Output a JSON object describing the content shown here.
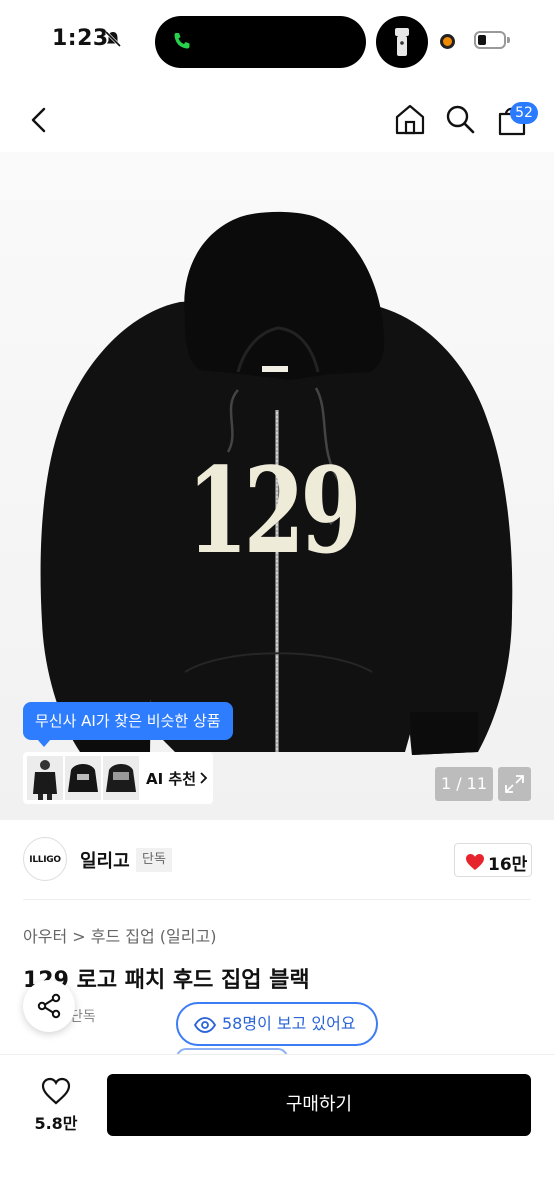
{
  "status_bar": {
    "time": "1:23"
  },
  "header": {
    "cart_count": "52"
  },
  "gallery": {
    "patch_text": "129",
    "ai_tooltip": "무신사 AI가 찾은 비슷한 상품",
    "ai_label": "AI 추천",
    "page_indicator": "1 / 11"
  },
  "brand": {
    "logo_text": "ILLIGO",
    "name": "일리고",
    "tag": "단독",
    "likes": "16만"
  },
  "product": {
    "breadcrumb": "아우터 > 후드 집업 (일리고)",
    "title": "129 로고 패치 후드 집업 블랙",
    "exclusive": "단독",
    "viewers": "58명이 보고 있어요"
  },
  "bottom_bar": {
    "wish_count": "5.8만",
    "buy_label": "구매하기"
  },
  "colors": {
    "accent": "#2f7dff",
    "like": "#e5242b",
    "buy_button": "#000000"
  }
}
